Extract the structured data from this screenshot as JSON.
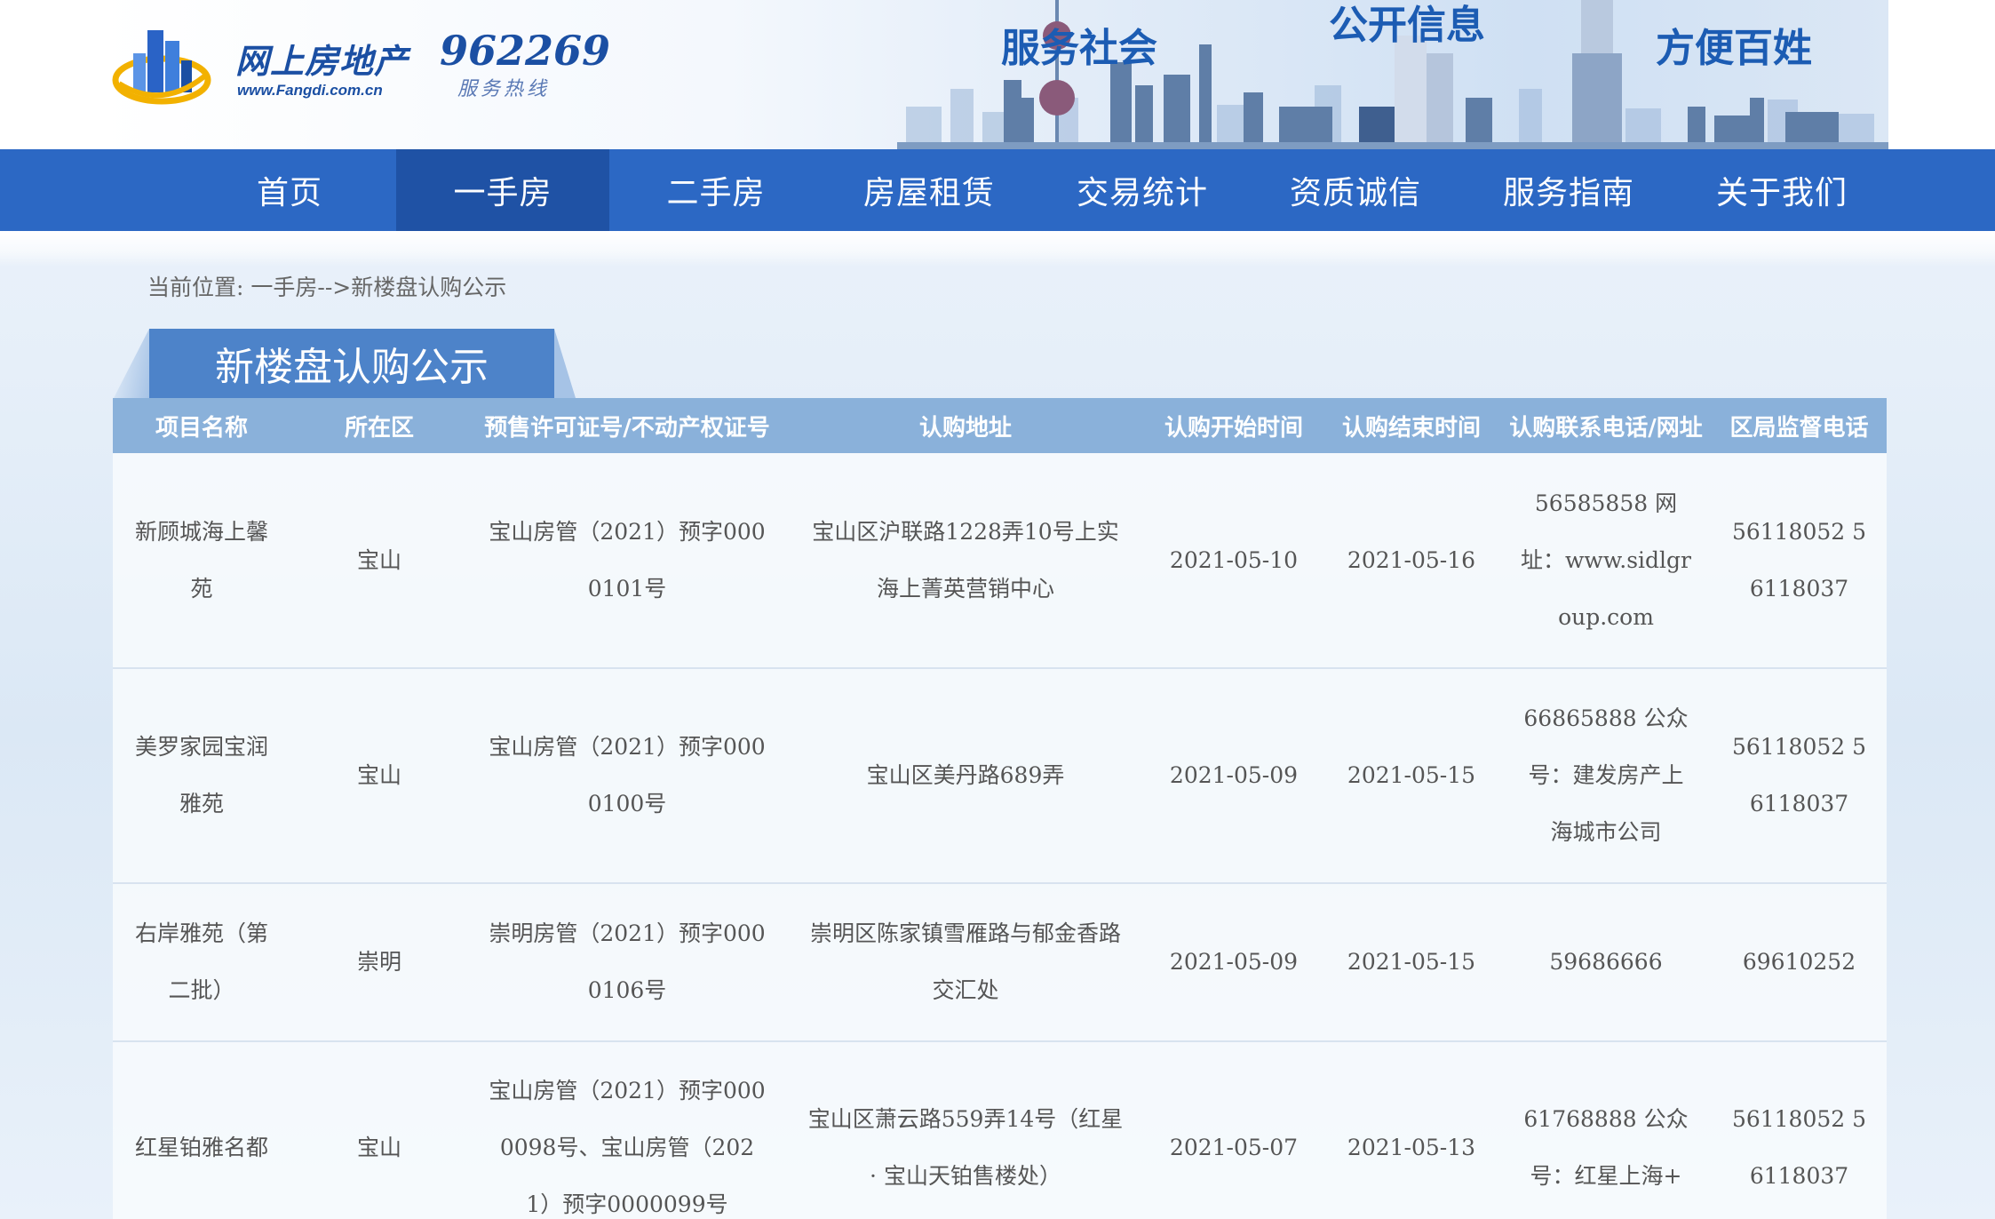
{
  "header": {
    "logo_text": "网上房地产",
    "logo_url": "www.Fangdi.com.cn",
    "hotline_number": "962269",
    "hotline_label": "服务热线",
    "slogans": [
      "服务社会",
      "公开信息",
      "方便百姓"
    ]
  },
  "nav": {
    "items": [
      {
        "label": "首页"
      },
      {
        "label": "一手房"
      },
      {
        "label": "二手房"
      },
      {
        "label": "房屋租赁"
      },
      {
        "label": "交易统计"
      },
      {
        "label": "资质诚信"
      },
      {
        "label": "服务指南"
      },
      {
        "label": "关于我们"
      }
    ],
    "active": "一手房"
  },
  "breadcrumb": "当前位置: 一手房-->新楼盘认购公示",
  "section_title": "新楼盘认购公示",
  "table": {
    "headers": [
      "项目名称",
      "所在区",
      "预售许可证号/不动产权证号",
      "认购地址",
      "认购开始时间",
      "认购结束时间",
      "认购联系电话/网址",
      "区局监督电话"
    ],
    "rows": [
      {
        "name": "新顾城海上馨苑",
        "district": "宝山",
        "permit": "宝山房管（2021）预字0000101号",
        "address": "宝山区沪联路1228弄10号上实海上菁英营销中心",
        "start": "2021-05-10",
        "end": "2021-05-16",
        "contact": "56585858 网址：www.sidlgroup.com",
        "supervision": "56118052 56118037"
      },
      {
        "name": "美罗家园宝润雅苑",
        "district": "宝山",
        "permit": "宝山房管（2021）预字0000100号",
        "address": "宝山区美丹路689弄",
        "start": "2021-05-09",
        "end": "2021-05-15",
        "contact": "66865888 公众号：建发房产上海城市公司",
        "supervision": "56118052 56118037"
      },
      {
        "name": "右岸雅苑（第二批）",
        "district": "崇明",
        "permit": "崇明房管（2021）预字0000106号",
        "address": "崇明区陈家镇雪雁路与郁金香路交汇处",
        "start": "2021-05-09",
        "end": "2021-05-15",
        "contact": "59686666",
        "supervision": "69610252"
      },
      {
        "name": "红星铂雅名都",
        "district": "宝山",
        "permit": "宝山房管（2021）预字0000098号、宝山房管（2021）预字0000099号",
        "address": "宝山区萧云路559弄14号（红星 · 宝山天铂售楼处）",
        "start": "2021-05-07",
        "end": "2021-05-13",
        "contact": "61768888 公众号：红星上海+",
        "supervision": "56118052 56118037"
      }
    ]
  },
  "colors": {
    "nav_bg": "#2c68c4",
    "nav_active": "#1f52a5",
    "table_header": "#8ab1da",
    "section_tab": "#4d83c9"
  }
}
